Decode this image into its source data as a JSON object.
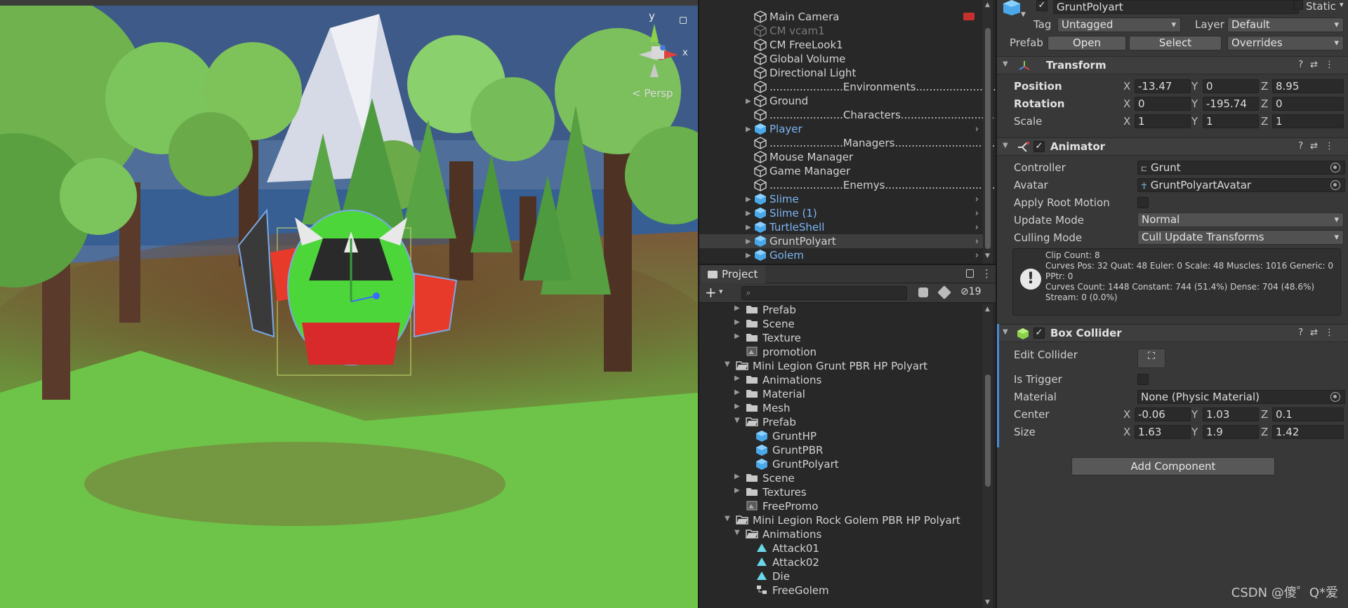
{
  "scene": {
    "persp_label": "< Persp",
    "gizmo_y": "y",
    "gizmo_x": "x"
  },
  "hierarchy": {
    "items": [
      {
        "label": "Main Camera",
        "style": "normal",
        "expandable": false,
        "has_chevron": false
      },
      {
        "label": "CM vcam1",
        "style": "dim",
        "expandable": false,
        "has_chevron": false
      },
      {
        "label": "CM FreeLook1",
        "style": "normal",
        "expandable": false,
        "has_chevron": false
      },
      {
        "label": "Global Volume",
        "style": "normal",
        "expandable": false,
        "has_chevron": false
      },
      {
        "label": "Directional Light",
        "style": "normal",
        "expandable": false,
        "has_chevron": false
      },
      {
        "label": "......................Environments.............................",
        "style": "normal",
        "expandable": false,
        "has_chevron": false
      },
      {
        "label": "Ground",
        "style": "normal",
        "expandable": true,
        "has_chevron": false
      },
      {
        "label": "......................Characters.................................",
        "style": "normal",
        "expandable": false,
        "has_chevron": false
      },
      {
        "label": "Player",
        "style": "prefab",
        "expandable": true,
        "has_chevron": true
      },
      {
        "label": "......................Managers.................................",
        "style": "normal",
        "expandable": false,
        "has_chevron": false
      },
      {
        "label": "Mouse Manager",
        "style": "normal",
        "expandable": false,
        "has_chevron": false
      },
      {
        "label": "Game Manager",
        "style": "normal",
        "expandable": false,
        "has_chevron": false
      },
      {
        "label": "......................Enemys.................................",
        "style": "normal",
        "expandable": false,
        "has_chevron": false
      },
      {
        "label": "Slime",
        "style": "prefab",
        "expandable": true,
        "has_chevron": true
      },
      {
        "label": "Slime (1)",
        "style": "prefab",
        "expandable": true,
        "has_chevron": true
      },
      {
        "label": "TurtleShell",
        "style": "prefab",
        "expandable": true,
        "has_chevron": true
      },
      {
        "label": "GruntPolyart",
        "style": "prefab-selected",
        "expandable": true,
        "has_chevron": true
      },
      {
        "label": "Golem",
        "style": "prefab",
        "expandable": true,
        "has_chevron": true
      }
    ]
  },
  "project": {
    "tab_label": "Project",
    "hidden_count": "19",
    "items": [
      {
        "label": "Prefab",
        "indent": 1,
        "icon": "folder",
        "fold": "closed"
      },
      {
        "label": "Scene",
        "indent": 1,
        "icon": "folder",
        "fold": "closed"
      },
      {
        "label": "Texture",
        "indent": 1,
        "icon": "folder",
        "fold": "closed"
      },
      {
        "label": "promotion",
        "indent": 1,
        "icon": "scene",
        "fold": "none"
      },
      {
        "label": "Mini Legion Grunt PBR HP Polyart",
        "indent": 0,
        "icon": "folder-open",
        "fold": "open"
      },
      {
        "label": "Animations",
        "indent": 1,
        "icon": "folder",
        "fold": "closed"
      },
      {
        "label": "Material",
        "indent": 1,
        "icon": "folder",
        "fold": "closed"
      },
      {
        "label": "Mesh",
        "indent": 1,
        "icon": "folder",
        "fold": "closed"
      },
      {
        "label": "Prefab",
        "indent": 1,
        "icon": "folder-open",
        "fold": "open"
      },
      {
        "label": "GruntHP",
        "indent": 2,
        "icon": "prefab",
        "fold": "none"
      },
      {
        "label": "GruntPBR",
        "indent": 2,
        "icon": "prefab",
        "fold": "none"
      },
      {
        "label": "GruntPolyart",
        "indent": 2,
        "icon": "prefab",
        "fold": "none"
      },
      {
        "label": "Scene",
        "indent": 1,
        "icon": "folder",
        "fold": "closed"
      },
      {
        "label": "Textures",
        "indent": 1,
        "icon": "folder",
        "fold": "closed"
      },
      {
        "label": "FreePromo",
        "indent": 1,
        "icon": "scene",
        "fold": "none"
      },
      {
        "label": "Mini Legion Rock Golem PBR HP Polyart",
        "indent": 0,
        "icon": "folder-open",
        "fold": "open"
      },
      {
        "label": "Animations",
        "indent": 1,
        "icon": "folder-open",
        "fold": "open"
      },
      {
        "label": "Attack01",
        "indent": 2,
        "icon": "anim",
        "fold": "none"
      },
      {
        "label": "Attack02",
        "indent": 2,
        "icon": "anim",
        "fold": "none"
      },
      {
        "label": "Die",
        "indent": 2,
        "icon": "anim",
        "fold": "none"
      },
      {
        "label": "FreeGolem",
        "indent": 2,
        "icon": "controller",
        "fold": "none"
      }
    ]
  },
  "inspector": {
    "object_name": "GruntPolyart",
    "static_label": "Static",
    "tag_label": "Tag",
    "tag_value": "Untagged",
    "layer_label": "Layer",
    "layer_value": "Default",
    "prefab_label": "Prefab",
    "open_btn": "Open",
    "select_btn": "Select",
    "overrides_btn": "Overrides",
    "transform": {
      "title": "Transform",
      "position_label": "Position",
      "rotation_label": "Rotation",
      "scale_label": "Scale",
      "position": {
        "x": "-13.47",
        "y": "0",
        "z": "8.95"
      },
      "rotation": {
        "x": "0",
        "y": "-195.74",
        "z": "0"
      },
      "scale": {
        "x": "1",
        "y": "1",
        "z": "1"
      }
    },
    "animator": {
      "title": "Animator",
      "controller_label": "Controller",
      "controller_value": "Grunt",
      "avatar_label": "Avatar",
      "avatar_value": "GruntPolyartAvatar",
      "apply_root_label": "Apply Root Motion",
      "update_mode_label": "Update Mode",
      "update_mode_value": "Normal",
      "culling_mode_label": "Culling Mode",
      "culling_mode_value": "Cull Update Transforms",
      "info_lines": [
        "Clip Count: 8",
        "Curves Pos: 32 Quat: 48 Euler: 0 Scale: 48 Muscles: 1016 Generic: 0 PPtr: 0",
        "Curves Count: 1448 Constant: 744 (51.4%) Dense: 704 (48.6%) Stream: 0 (0.0%)"
      ]
    },
    "box_collider": {
      "title": "Box Collider",
      "edit_label": "Edit Collider",
      "trigger_label": "Is Trigger",
      "material_label": "Material",
      "material_value": "None (Physic Material)",
      "center_label": "Center",
      "size_label": "Size",
      "center": {
        "x": "-0.06",
        "y": "1.03",
        "z": "0.1"
      },
      "size": {
        "x": "1.63",
        "y": "1.9",
        "z": "1.42"
      }
    },
    "add_component": "Add Component",
    "axis": {
      "x": "X",
      "y": "Y",
      "z": "Z"
    }
  },
  "watermark": "CSDN @傻゜Q*爱",
  "colors": {
    "accent_blue": "#7cb6f5",
    "selection": "#3e3e3e",
    "panel": "#383838"
  }
}
